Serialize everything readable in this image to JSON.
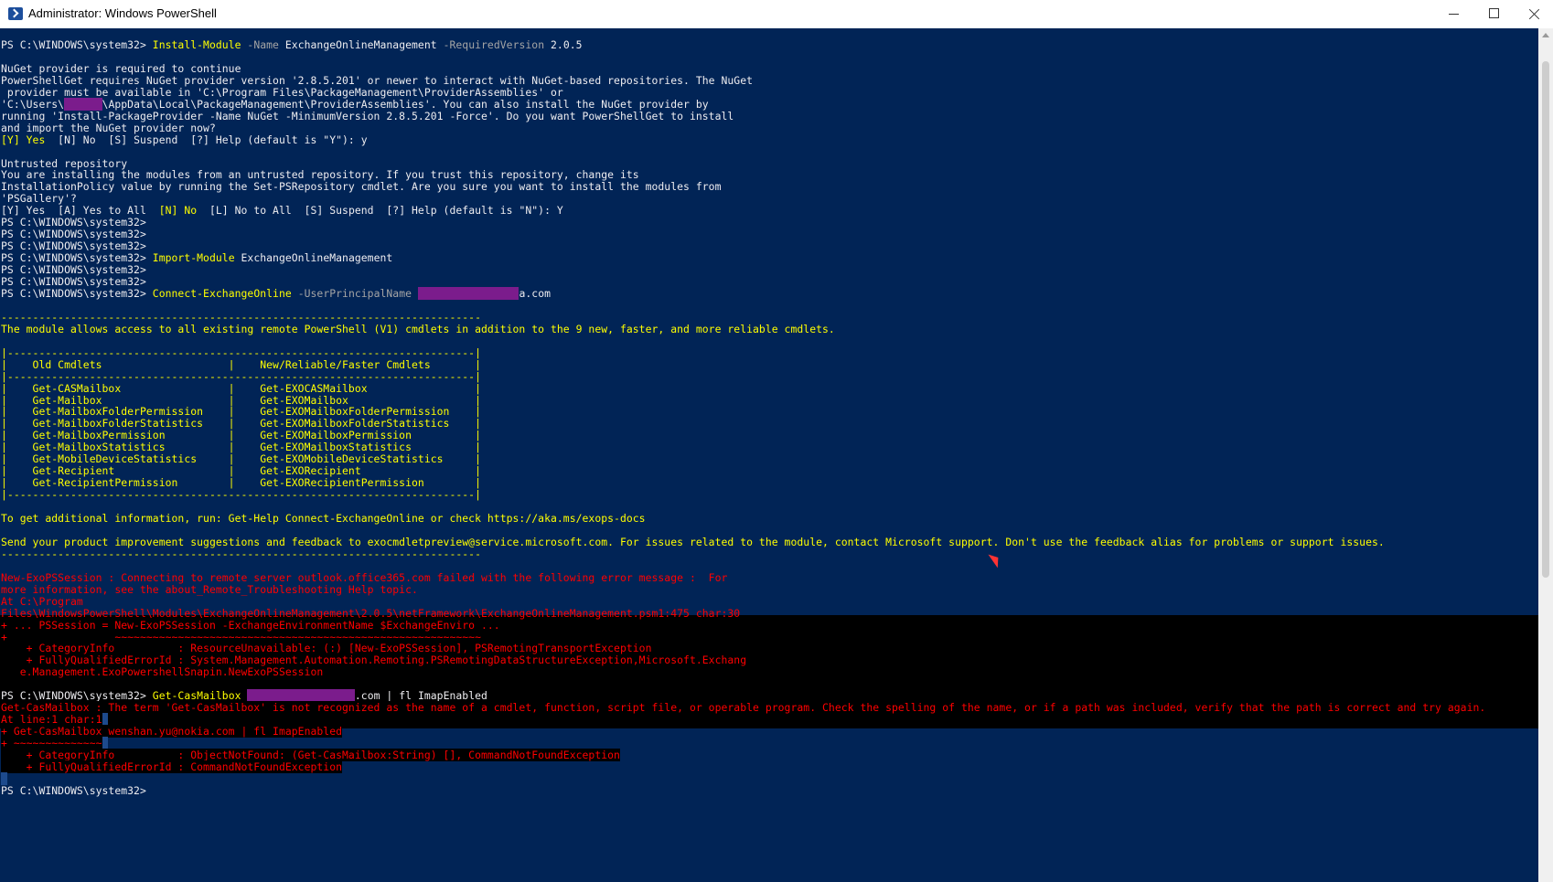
{
  "window": {
    "title": "Administrator: Windows PowerShell"
  },
  "console_lines": [
    {
      "row": 0,
      "tokens": [
        {
          "text": "PS C:\\WINDOWS\\system32> ",
          "style": "default"
        },
        {
          "text": "Install-Module",
          "style": "cmd"
        },
        {
          "text": " -Name ",
          "style": "param"
        },
        {
          "text": "ExchangeOnlineManagement",
          "style": "arg"
        },
        {
          "text": " -RequiredVersion ",
          "style": "param"
        },
        {
          "text": "2.0.5",
          "style": "arg"
        }
      ]
    },
    {
      "row": 2,
      "tokens": [
        {
          "text": "NuGet provider is required to continue",
          "style": "default"
        }
      ]
    },
    {
      "row": 3,
      "tokens": [
        {
          "text": "PowerShellGet requires NuGet provider version '2.8.5.201' or newer to interact with NuGet-based repositories. The NuGet",
          "style": "default"
        }
      ]
    },
    {
      "row": 4,
      "tokens": [
        {
          "text": " provider must be available in 'C:\\Program Files\\PackageManagement\\ProviderAssemblies' or",
          "style": "default"
        }
      ]
    },
    {
      "row": 5,
      "tokens": [
        {
          "text": "'C:\\Users\\",
          "style": "default"
        },
        {
          "text": "XXXXXX",
          "style": "redact"
        },
        {
          "text": "\\AppData\\Local\\PackageManagement\\ProviderAssemblies'. You can also install the NuGet provider by",
          "style": "default"
        }
      ]
    },
    {
      "row": 6,
      "tokens": [
        {
          "text": "running 'Install-PackageProvider -Name NuGet -MinimumVersion 2.8.5.201 -Force'. Do you want PowerShellGet to install",
          "style": "default"
        }
      ]
    },
    {
      "row": 7,
      "tokens": [
        {
          "text": "and import the NuGet provider now?",
          "style": "default"
        }
      ]
    },
    {
      "row": 8,
      "tokens": [
        {
          "text": "[Y] Yes",
          "style": "warn"
        },
        {
          "text": "  [N] No  [S] Suspend  [?] Help (default is \"Y\"): y",
          "style": "default"
        }
      ]
    },
    {
      "row": 10,
      "tokens": [
        {
          "text": "Untrusted repository",
          "style": "default"
        }
      ]
    },
    {
      "row": 11,
      "tokens": [
        {
          "text": "You are installing the modules from an untrusted repository. If you trust this repository, change its",
          "style": "default"
        }
      ]
    },
    {
      "row": 12,
      "tokens": [
        {
          "text": "InstallationPolicy value by running the Set-PSRepository cmdlet. Are you sure you want to install the modules from",
          "style": "default"
        }
      ]
    },
    {
      "row": 13,
      "tokens": [
        {
          "text": "'PSGallery'?",
          "style": "default"
        }
      ]
    },
    {
      "row": 14,
      "tokens": [
        {
          "text": "[Y] Yes  [A] Yes to All  ",
          "style": "default"
        },
        {
          "text": "[N] No",
          "style": "warn"
        },
        {
          "text": "  [L] No to All  [S] Suspend  [?] Help (default is \"N\"): Y",
          "style": "default"
        }
      ]
    },
    {
      "row": 15,
      "tokens": [
        {
          "text": "PS C:\\WINDOWS\\system32>",
          "style": "default"
        }
      ]
    },
    {
      "row": 16,
      "tokens": [
        {
          "text": "PS C:\\WINDOWS\\system32>",
          "style": "default"
        }
      ]
    },
    {
      "row": 17,
      "tokens": [
        {
          "text": "PS C:\\WINDOWS\\system32>",
          "style": "default"
        }
      ]
    },
    {
      "row": 18,
      "tokens": [
        {
          "text": "PS C:\\WINDOWS\\system32> ",
          "style": "default"
        },
        {
          "text": "Import-Module",
          "style": "cmd"
        },
        {
          "text": " ExchangeOnlineManagement",
          "style": "arg"
        }
      ]
    },
    {
      "row": 19,
      "tokens": [
        {
          "text": "PS C:\\WINDOWS\\system32>",
          "style": "default"
        }
      ]
    },
    {
      "row": 20,
      "tokens": [
        {
          "text": "PS C:\\WINDOWS\\system32>",
          "style": "default"
        }
      ]
    },
    {
      "row": 21,
      "tokens": [
        {
          "text": "PS C:\\WINDOWS\\system32> ",
          "style": "default"
        },
        {
          "text": "Connect-ExchangeOnline",
          "style": "cmd"
        },
        {
          "text": " -UserPrincipalName ",
          "style": "param"
        },
        {
          "text": "XXXXXXXXXXXXXXXX",
          "style": "redact"
        },
        {
          "text": "a.com",
          "style": "arg"
        }
      ]
    },
    {
      "row": 23,
      "tokens": [
        {
          "text": "----------------------------------------------------------------------------",
          "style": "warn"
        }
      ]
    },
    {
      "row": 24,
      "tokens": [
        {
          "text": "The module allows access to all existing remote PowerShell (V1) cmdlets in addition to the 9 new, faster, and more reliable cmdlets.",
          "style": "warn"
        }
      ]
    },
    {
      "row": 26,
      "tokens": [
        {
          "text": "|--------------------------------------------------------------------------|",
          "style": "warn"
        }
      ]
    },
    {
      "row": 27,
      "tokens": [
        {
          "text": "|    Old Cmdlets                    |    New/Reliable/Faster Cmdlets       |",
          "style": "warn"
        }
      ]
    },
    {
      "row": 28,
      "tokens": [
        {
          "text": "|--------------------------------------------------------------------------|",
          "style": "warn"
        }
      ]
    },
    {
      "row": 29,
      "tokens": [
        {
          "text": "|    Get-CASMailbox                 |    Get-EXOCASMailbox                 |",
          "style": "warn"
        }
      ]
    },
    {
      "row": 30,
      "tokens": [
        {
          "text": "|    Get-Mailbox                    |    Get-EXOMailbox                    |",
          "style": "warn"
        }
      ]
    },
    {
      "row": 31,
      "tokens": [
        {
          "text": "|    Get-MailboxFolderPermission    |    Get-EXOMailboxFolderPermission    |",
          "style": "warn"
        }
      ]
    },
    {
      "row": 32,
      "tokens": [
        {
          "text": "|    Get-MailboxFolderStatistics    |    Get-EXOMailboxFolderStatistics    |",
          "style": "warn"
        }
      ]
    },
    {
      "row": 33,
      "tokens": [
        {
          "text": "|    Get-MailboxPermission          |    Get-EXOMailboxPermission          |",
          "style": "warn"
        }
      ]
    },
    {
      "row": 34,
      "tokens": [
        {
          "text": "|    Get-MailboxStatistics          |    Get-EXOMailboxStatistics          |",
          "style": "warn"
        }
      ]
    },
    {
      "row": 35,
      "tokens": [
        {
          "text": "|    Get-MobileDeviceStatistics     |    Get-EXOMobileDeviceStatistics     |",
          "style": "warn"
        }
      ]
    },
    {
      "row": 36,
      "tokens": [
        {
          "text": "|    Get-Recipient                  |    Get-EXORecipient                  |",
          "style": "warn"
        }
      ]
    },
    {
      "row": 37,
      "tokens": [
        {
          "text": "|    Get-RecipientPermission        |    Get-EXORecipientPermission        |",
          "style": "warn"
        }
      ]
    },
    {
      "row": 38,
      "tokens": [
        {
          "text": "|--------------------------------------------------------------------------|",
          "style": "warn"
        }
      ]
    },
    {
      "row": 40,
      "tokens": [
        {
          "text": "To get additional information, run: Get-Help Connect-ExchangeOnline or check https://aka.ms/exops-docs",
          "style": "warn"
        }
      ]
    },
    {
      "row": 42,
      "tokens": [
        {
          "text": "Send your product improvement suggestions and feedback to exocmdletpreview@service.microsoft.com. For issues related to the module, contact Microsoft support. Don't use the feedback alias for problems or support issues.",
          "style": "warn"
        }
      ]
    },
    {
      "row": 43,
      "tokens": [
        {
          "text": "----------------------------------------------------------------------------",
          "style": "warn"
        }
      ]
    },
    {
      "row": 45,
      "tokens": [
        {
          "text": "New-ExoPSSession : Connecting to remote server outlook.office365.com failed with the following error message :  For",
          "style": "error"
        }
      ]
    },
    {
      "row": 46,
      "tokens": [
        {
          "text": "more information, see the about_Remote_Troubleshooting Help topic.",
          "style": "error"
        }
      ]
    },
    {
      "row": 47,
      "tokens": [
        {
          "text": "At C:\\Program",
          "style": "error"
        }
      ]
    },
    {
      "row": 48,
      "tokens": [
        {
          "text": "Files\\WindowsPowerShell\\Modules\\ExchangeOnlineManagement\\2.0.5\\netFramework\\ExchangeOnlineManagement.psm1:475 char:30",
          "style": "error"
        }
      ]
    },
    {
      "row": 49,
      "tokens": [
        {
          "text": "+ ... PSSession = New-ExoPSSession -ExchangeEnvironmentName $ExchangeEnviro ...",
          "style": "error"
        }
      ]
    },
    {
      "row": 50,
      "tokens": [
        {
          "text": "+                 ~~~~~~~~~~~~~~~~~~~~~~~~~~~~~~~~~~~~~~~~~~~~~~~~~~~~~~~~~~",
          "style": "error"
        }
      ]
    },
    {
      "row": 51,
      "tokens": [
        {
          "text": "    + CategoryInfo          : ResourceUnavailable: (:) [New-ExoPSSession], PSRemotingTransportException",
          "style": "error"
        }
      ]
    },
    {
      "row": 52,
      "tokens": [
        {
          "text": "    + FullyQualifiedErrorId : System.Management.Automation.Remoting.PSRemotingDataStructureException,Microsoft.Exchang",
          "style": "error"
        }
      ]
    },
    {
      "row": 53,
      "tokens": [
        {
          "text": "   e.Management.ExoPowershellSnapin.NewExoPSSession",
          "style": "error"
        }
      ]
    },
    {
      "row": 55,
      "tokens": [
        {
          "text": "PS C:\\WINDOWS\\system32> ",
          "style": "default"
        },
        {
          "text": "Get-CasMailbox",
          "style": "cmd"
        },
        {
          "text": " ",
          "style": "default"
        },
        {
          "text": "XXXXXXXXXXXXXXXXX",
          "style": "redact"
        },
        {
          "text": ".com | fl ImapEnabled",
          "style": "arg"
        }
      ]
    },
    {
      "row": 56,
      "tokens": [
        {
          "text": "Get-CasMailbox : The term 'Get-CasMailbox' is not recognized as the name of a cmdlet, function, script file, or operable program. Check the spelling of the name, or if a path was included, verify that the path is correct and try again.",
          "style": "errbg"
        }
      ]
    },
    {
      "row": 57,
      "tokens": [
        {
          "text": "At line:1 char:1",
          "style": "errbg"
        },
        {
          "text": " ",
          "style": "sel"
        }
      ]
    },
    {
      "row": 58,
      "tokens": [
        {
          "text": "+ Get-CasMailbox wenshan.yu@nokia.com | fl ImapEnabled",
          "style": "errbg"
        }
      ]
    },
    {
      "row": 59,
      "tokens": [
        {
          "text": "+ ~~~~~~~~~~~~~~",
          "style": "errbg"
        },
        {
          "text": " ",
          "style": "sel"
        }
      ]
    },
    {
      "row": 60,
      "tokens": [
        {
          "text": "    + CategoryInfo          : ObjectNotFound: (Get-CasMailbox:String) [], CommandNotFoundException",
          "style": "errbg"
        }
      ]
    },
    {
      "row": 61,
      "tokens": [
        {
          "text": "    + FullyQualifiedErrorId : CommandNotFoundException",
          "style": "errbg"
        }
      ]
    },
    {
      "row": 62,
      "tokens": [
        {
          "text": " ",
          "style": "sel"
        }
      ]
    },
    {
      "row": 63,
      "tokens": [
        {
          "text": "PS C:\\WINDOWS\\system32>",
          "style": "default"
        }
      ]
    }
  ]
}
